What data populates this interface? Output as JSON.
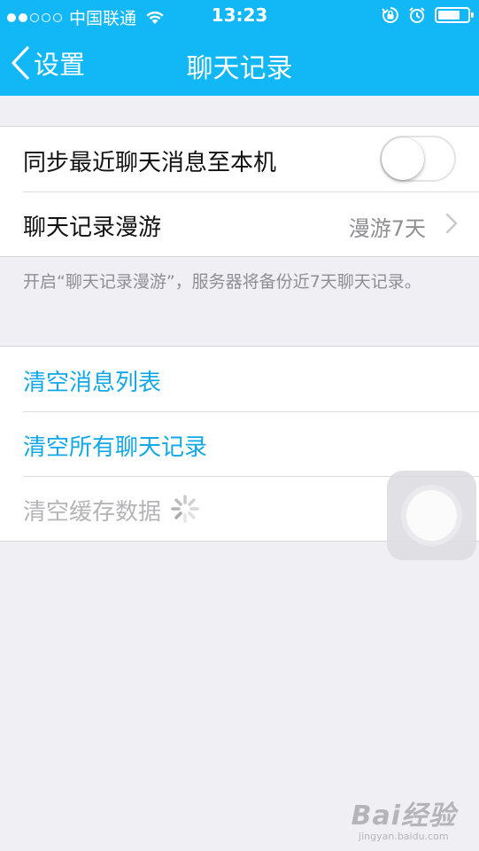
{
  "status_bar": {
    "carrier": "中国联通",
    "time": "13:23",
    "signal_dots_filled": 2,
    "signal_dots_total": 5,
    "battery_level": 0.75
  },
  "nav": {
    "back_label": "设置",
    "title": "聊天记录"
  },
  "settings": {
    "sync_label": "同步最近聊天消息至本机",
    "sync_on": false,
    "roam_label": "聊天记录漫游",
    "roam_value": "漫游7天",
    "roam_note": "开启“聊天记录漫游”，服务器将备份近7天聊天记录。"
  },
  "actions": {
    "clear_list": "清空消息列表",
    "clear_all": "清空所有聊天记录",
    "clear_cache": "清空缓存数据"
  },
  "watermark": {
    "logo": "Bai经验",
    "sub": "jingyan.baidu.com"
  },
  "colors": {
    "accent": "#12b7f5",
    "action_text": "#12a7e8",
    "background": "#efeff4"
  }
}
